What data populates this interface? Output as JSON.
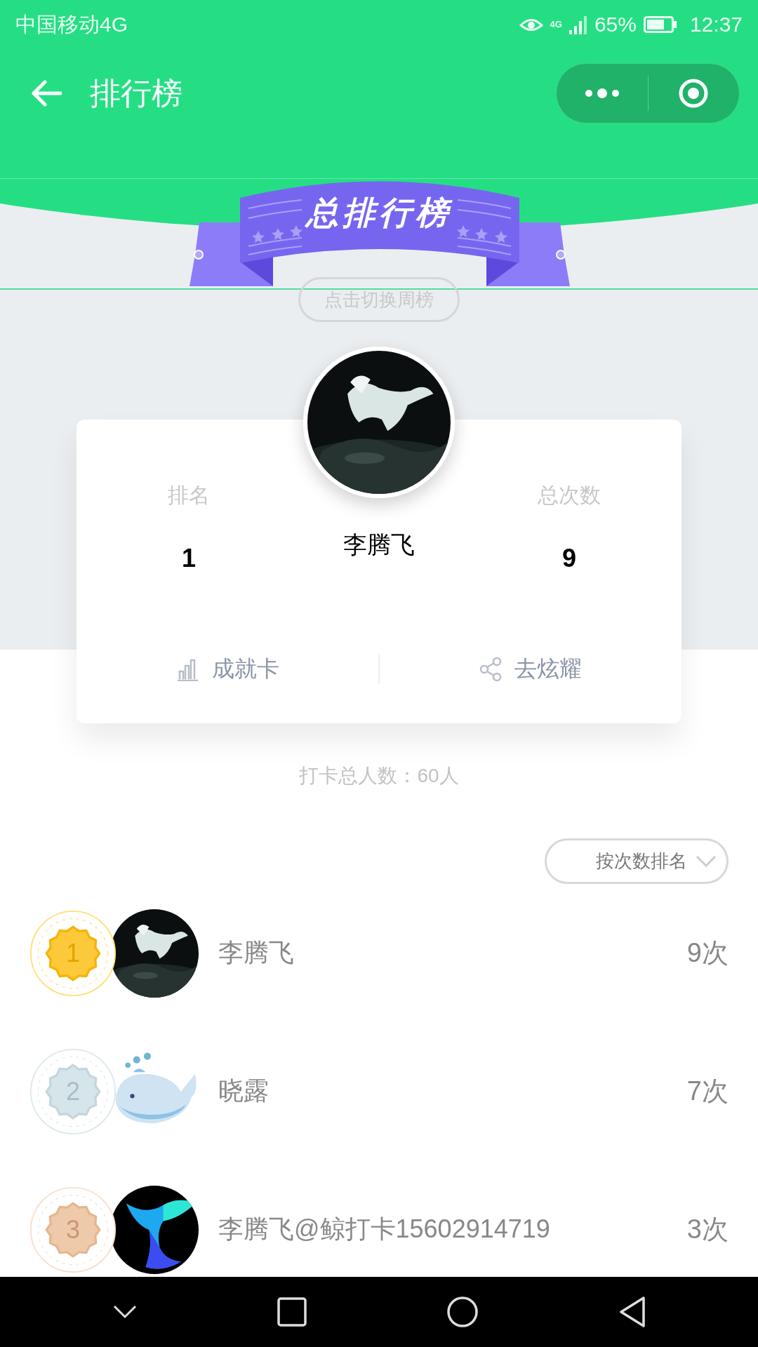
{
  "status_bar": {
    "carrier": "中国移动4G",
    "network": "4G",
    "battery": "65%",
    "time": "12:37"
  },
  "header": {
    "title": "排行榜"
  },
  "banner": {
    "title": "总排行榜",
    "switch_label": "点击切换周榜"
  },
  "profile": {
    "rank_label": "排名",
    "rank": "1",
    "name": "李腾飞",
    "total_label": "总次数",
    "total": "9",
    "actions": [
      {
        "kind": "card",
        "label": "成就卡"
      },
      {
        "kind": "share",
        "label": "去炫耀"
      }
    ]
  },
  "participants": "打卡总人数：60人",
  "sort": {
    "label": "按次数排名"
  },
  "rankings": [
    {
      "rank": "1",
      "kind": "gold",
      "name": "李腾飞",
      "count": "9次"
    },
    {
      "rank": "2",
      "kind": "silver",
      "name": "晓露",
      "count": "7次"
    },
    {
      "rank": "3",
      "kind": "bronze",
      "name": "李腾飞@鲸打卡15602914719",
      "count": "3次"
    }
  ]
}
